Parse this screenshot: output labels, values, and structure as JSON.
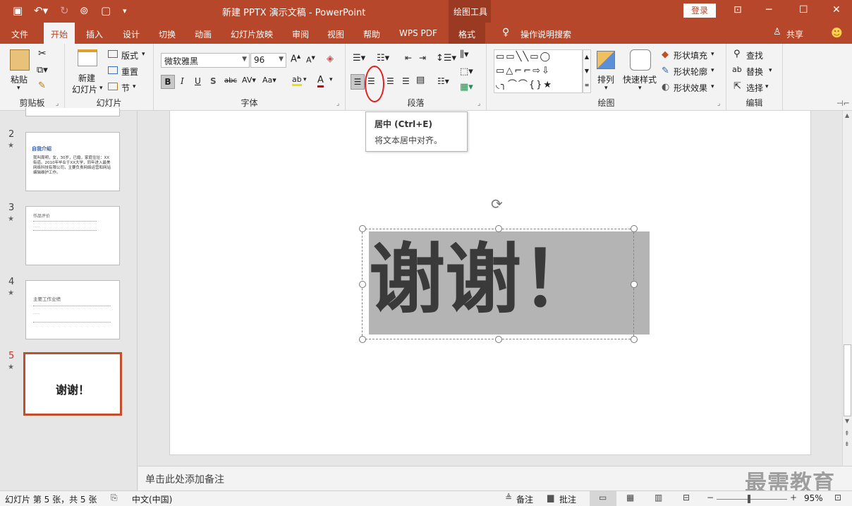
{
  "titlebar": {
    "title": "新建 PPTX 演示文稿  -  PowerPoint",
    "context_tab": "绘图工具",
    "login": "登录"
  },
  "tabs": [
    "文件",
    "开始",
    "插入",
    "设计",
    "切换",
    "动画",
    "幻灯片放映",
    "审阅",
    "视图",
    "帮助",
    "WPS PDF",
    "格式"
  ],
  "search": "操作说明搜索",
  "share": "共享",
  "ribbon": {
    "clipboard": {
      "paste": "粘贴",
      "label": "剪贴板"
    },
    "slides": {
      "new_slide_1": "新建",
      "new_slide_2": "幻灯片",
      "layout": "版式",
      "reset": "重置",
      "section": "节",
      "label": "幻灯片"
    },
    "font": {
      "font_name": "微软雅黑",
      "font_size": "96",
      "label": "字体"
    },
    "paragraph": {
      "label": "段落"
    },
    "drawing": {
      "arrange": "排列",
      "quick_styles": "快速样式",
      "shape_fill": "形状填充",
      "shape_outline": "形状轮廓",
      "shape_effects": "形状效果",
      "label": "绘图"
    },
    "editing": {
      "find": "查找",
      "replace": "替换",
      "select": "选择",
      "label": "编辑"
    }
  },
  "tooltip": {
    "title": "居中 (Ctrl+E)",
    "desc": "将文本居中对齐。"
  },
  "thumbnails": [
    {
      "num": "2",
      "title": "自我介绍",
      "body": "我叫周明，女，30岁，已婚，家庭住址：XX街道。2010年毕业于XX大学，同年进入最美网络科技有限公司，主要负责网络运营和网站编辑维护工作。"
    },
    {
      "num": "3",
      "title": "作品评价",
      "body": "······"
    },
    {
      "num": "4",
      "title": "主要工作业绩",
      "body": "······"
    },
    {
      "num": "5",
      "title": "谢谢！",
      "body": ""
    }
  ],
  "slide": {
    "text": "谢谢！"
  },
  "notes": {
    "placeholder": "单击此处添加备注"
  },
  "watermark": "最需教育",
  "status": {
    "slide_info": "幻灯片 第 5 张，共 5 张",
    "language": "中文(中国)",
    "notes_btn": "备注",
    "comments_btn": "批注",
    "zoom": "95%"
  },
  "colors": {
    "accent": "#b7472a",
    "slide_text": "#3a3a3a",
    "text_box_fill": "#b4b4b4"
  }
}
